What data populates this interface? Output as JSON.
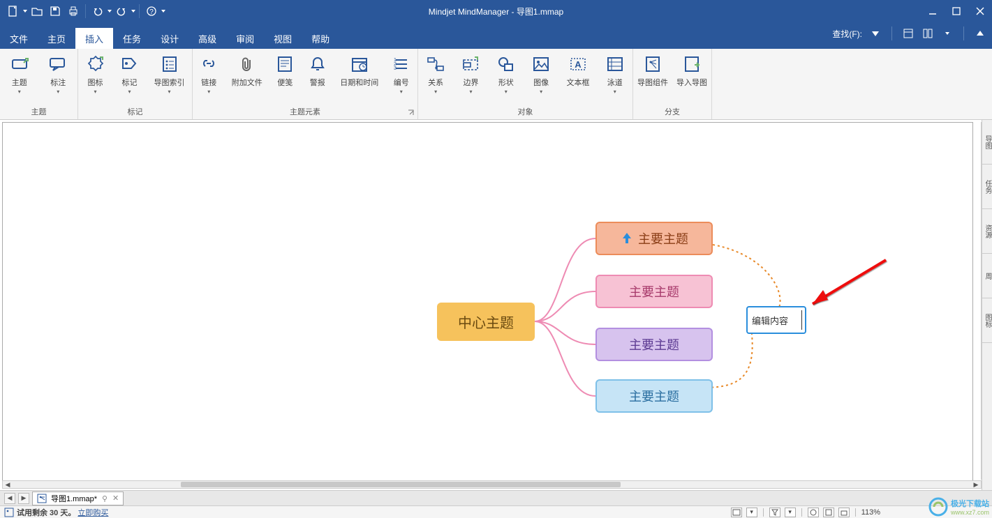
{
  "app": {
    "title": "Mindjet MindManager - 导图1.mmap"
  },
  "menubar": {
    "items": [
      "文件",
      "主页",
      "插入",
      "任务",
      "设计",
      "高级",
      "审阅",
      "视图",
      "帮助"
    ],
    "active_index": 2,
    "find_label": "查找(F):"
  },
  "ribbon": {
    "groups": [
      {
        "label": "主题",
        "items": [
          {
            "key": "topic",
            "label": "主题",
            "drop": true
          },
          {
            "key": "callout",
            "label": "标注",
            "drop": true
          }
        ]
      },
      {
        "label": "标记",
        "items": [
          {
            "key": "icon",
            "label": "图标",
            "drop": true
          },
          {
            "key": "tag",
            "label": "标记",
            "drop": true
          },
          {
            "key": "index",
            "label": "导图索引",
            "drop": true
          }
        ]
      },
      {
        "label": "主题元素",
        "launcher": true,
        "items": [
          {
            "key": "link",
            "label": "链接",
            "drop": true
          },
          {
            "key": "attach",
            "label": "附加文件"
          },
          {
            "key": "note",
            "label": "便笺"
          },
          {
            "key": "alert",
            "label": "警报"
          },
          {
            "key": "datetime",
            "label": "日期和时间"
          },
          {
            "key": "number",
            "label": "编号",
            "drop": true
          }
        ]
      },
      {
        "label": "对象",
        "items": [
          {
            "key": "relation",
            "label": "关系",
            "drop": true
          },
          {
            "key": "boundary",
            "label": "边界",
            "drop": true
          },
          {
            "key": "shape",
            "label": "形状",
            "drop": true
          },
          {
            "key": "image",
            "label": "图像",
            "drop": true
          },
          {
            "key": "textbox",
            "label": "文本框"
          },
          {
            "key": "swim",
            "label": "泳道",
            "drop": true
          }
        ]
      },
      {
        "label": "分支",
        "items": [
          {
            "key": "parts",
            "label": "导图组件"
          },
          {
            "key": "import",
            "label": "导入导图"
          }
        ]
      }
    ]
  },
  "mindmap": {
    "central": "中心主题",
    "topics": [
      "主要主题",
      "主要主题",
      "主要主题",
      "主要主题"
    ],
    "callout_value": "编辑内容"
  },
  "doctab": {
    "name": "导图1.mmap*"
  },
  "status": {
    "trial_text": "试用剩余 30 天。",
    "trial_link": "立即购买",
    "zoom": "113%"
  },
  "sidebar_tabs": [
    "导图",
    "任务",
    "资源",
    "周",
    "图标"
  ],
  "watermark": {
    "name": "极光下载站",
    "url": "www.xz7.com"
  }
}
